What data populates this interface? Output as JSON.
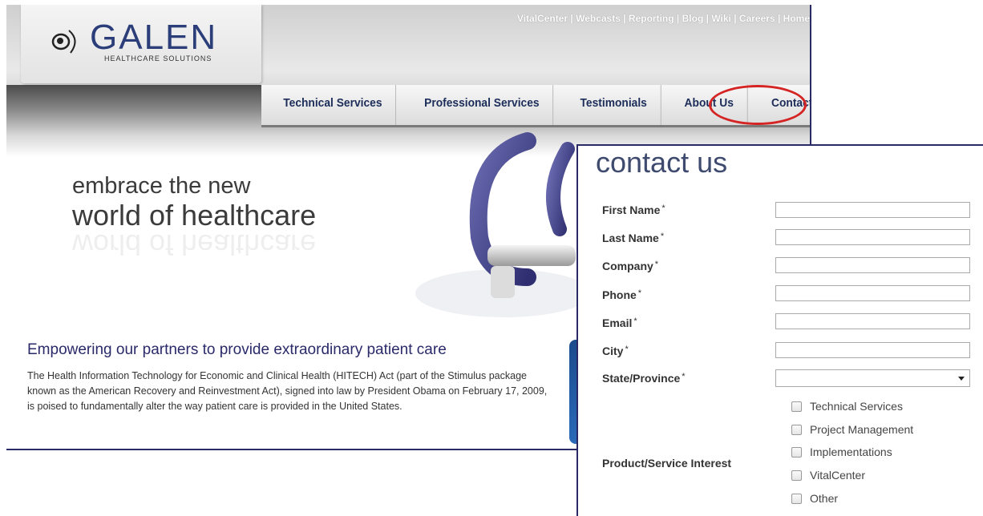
{
  "logo": {
    "word": "GALEN",
    "subtitle": "HEALTHCARE SOLUTIONS"
  },
  "top_links": [
    "VitalCenter",
    "Webcasts",
    "Reporting",
    "Blog",
    "Wiki",
    "Careers",
    "Home"
  ],
  "top_links_separator": " | ",
  "nav": [
    "Technical Services",
    "Professional Services",
    "Testimonials",
    "About Us",
    "Contact Us"
  ],
  "hero": {
    "line1": "embrace the new",
    "line2": "world of healthcare"
  },
  "section": {
    "title": "Empowering our partners to provide extraordinary patient care",
    "body": "The Health Information Technology for Economic and Clinical Health (HITECH) Act (part of the Stimulus package known as the American Recovery and Reinvestment Act), signed into law by President Obama on February 17, 2009, is poised to fundamentally alter the way patient care is provided in the United States."
  },
  "contact": {
    "title": "contact us",
    "required_marker": "*",
    "fields": [
      {
        "label": "First Name",
        "value": ""
      },
      {
        "label": "Last Name",
        "value": ""
      },
      {
        "label": "Company",
        "value": ""
      },
      {
        "label": "Phone",
        "value": ""
      },
      {
        "label": "Email",
        "value": ""
      },
      {
        "label": "City",
        "value": ""
      }
    ],
    "state": {
      "label": "State/Province",
      "value": ""
    },
    "interest_label": "Product/Service Interest",
    "interests": [
      "Technical Services",
      "Project Management",
      "Implementations",
      "VitalCenter",
      "Other"
    ]
  },
  "colors": {
    "nav_text": "#1c2d5a",
    "highlight": "#d42424",
    "heading": "#2a2a6a"
  }
}
